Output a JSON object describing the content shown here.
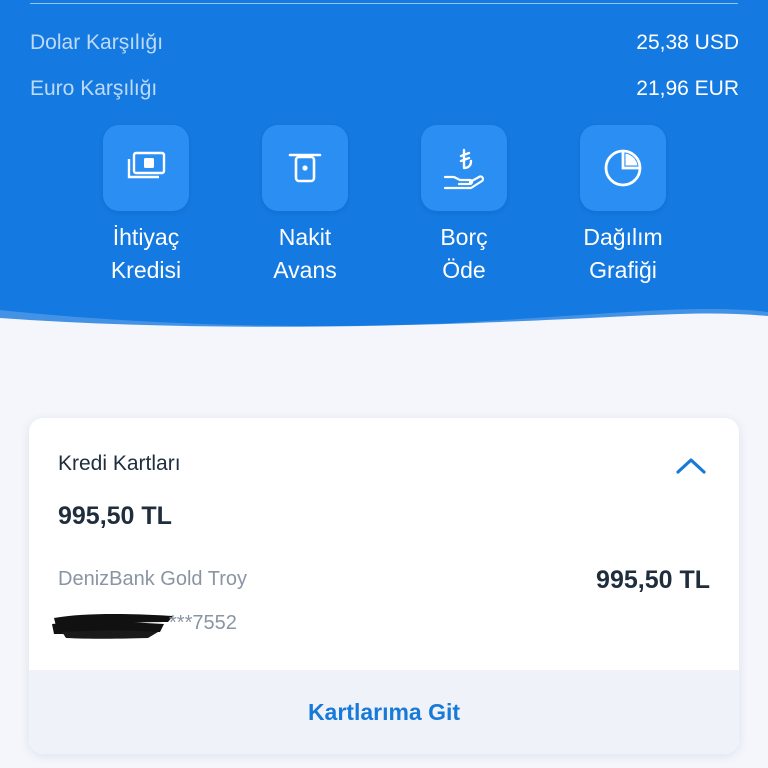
{
  "rates": [
    {
      "label": "Dolar Karşılığı",
      "value": "25,38 USD"
    },
    {
      "label": "Euro Karşılığı",
      "value": "21,96 EUR"
    }
  ],
  "actions": [
    {
      "icon": "money-icon",
      "label": "İhtiyaç\nKredisi"
    },
    {
      "icon": "atm-icon",
      "label": "Nakit\nAvans"
    },
    {
      "icon": "lira-hand-icon",
      "label": "Borç\nÖde"
    },
    {
      "icon": "pie-chart-icon",
      "label": "Dağılım\nGrafiği"
    }
  ],
  "card": {
    "title": "Kredi Kartları",
    "total": "995,50 TL",
    "item_name": "DenizBank Gold Troy",
    "item_amount": "995,50 TL",
    "item_number": "***7552",
    "footer": "Kartlarıma Git"
  },
  "colors": {
    "brand": "#1479e0",
    "accent": "#1779d8",
    "text": "#1f2d3d",
    "muted": "#8a95a3"
  }
}
